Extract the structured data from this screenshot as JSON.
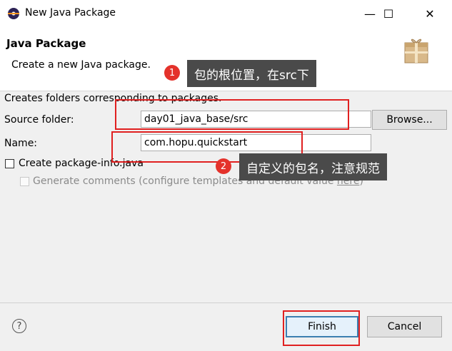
{
  "window": {
    "title": "New Java Package",
    "minimize": "—",
    "maximize": "☐",
    "close": "✕"
  },
  "banner": {
    "title": "Java Package",
    "message": "Create a new Java package."
  },
  "form": {
    "description": "Creates folders corresponding to packages.",
    "source_folder_label": "Source folder:",
    "source_folder_value": "day01_java_base/src",
    "browse_label": "Browse...",
    "name_label": "Name:",
    "name_value": "com.hopu.quickstart",
    "create_package_info": {
      "label": "Create package-info.java",
      "checked": false
    },
    "generate_comments": {
      "label_prefix": "Generate comments (configure templates and default value ",
      "link": "here",
      "label_suffix": ")",
      "checked": false,
      "enabled": false
    }
  },
  "annotations": [
    {
      "number": "1",
      "text": "包的根位置，在src下"
    },
    {
      "number": "2",
      "text": "自定义的包名，注意规范"
    }
  ],
  "footer": {
    "help_symbol": "?",
    "finish_label": "Finish",
    "cancel_label": "Cancel"
  }
}
